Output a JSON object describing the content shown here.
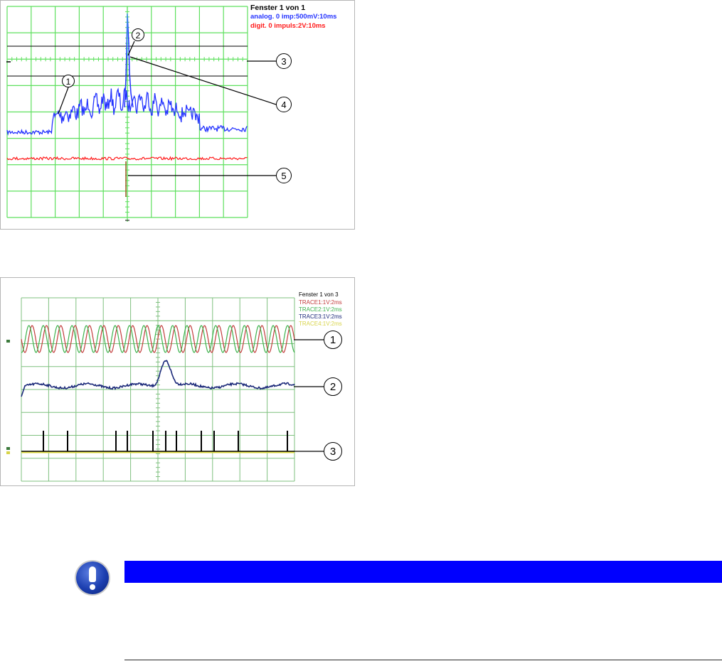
{
  "scope1": {
    "title": "Fenster 1 von 1",
    "channel1": "analog. 0 imp:500mV:10ms",
    "channel2": "digit. 0 impuls:2V:10ms",
    "colors": {
      "grid": "#5ee05e",
      "analog": "#2433ff",
      "digital": "#ff1a1a",
      "marker": "#000000"
    },
    "callouts": [
      "1",
      "2",
      "3",
      "4",
      "5"
    ]
  },
  "scope2": {
    "title": "Fenster 1 von 3",
    "traces": [
      {
        "label": "TRACE1:1V:2ms",
        "color": "#c23b3b"
      },
      {
        "label": "TRACE2:1V:2ms",
        "color": "#3cb24b"
      },
      {
        "label": "TRACE3:1V:2ms",
        "color": "#1c2a7a"
      },
      {
        "label": "TRACE4:1V:2ms",
        "color": "#e6e24a"
      }
    ],
    "grid_color": "#7fc07f",
    "callouts": [
      "1",
      "2",
      "3"
    ]
  },
  "note": {
    "icon": "exclamation-icon",
    "bar_color": "#0000ff"
  }
}
